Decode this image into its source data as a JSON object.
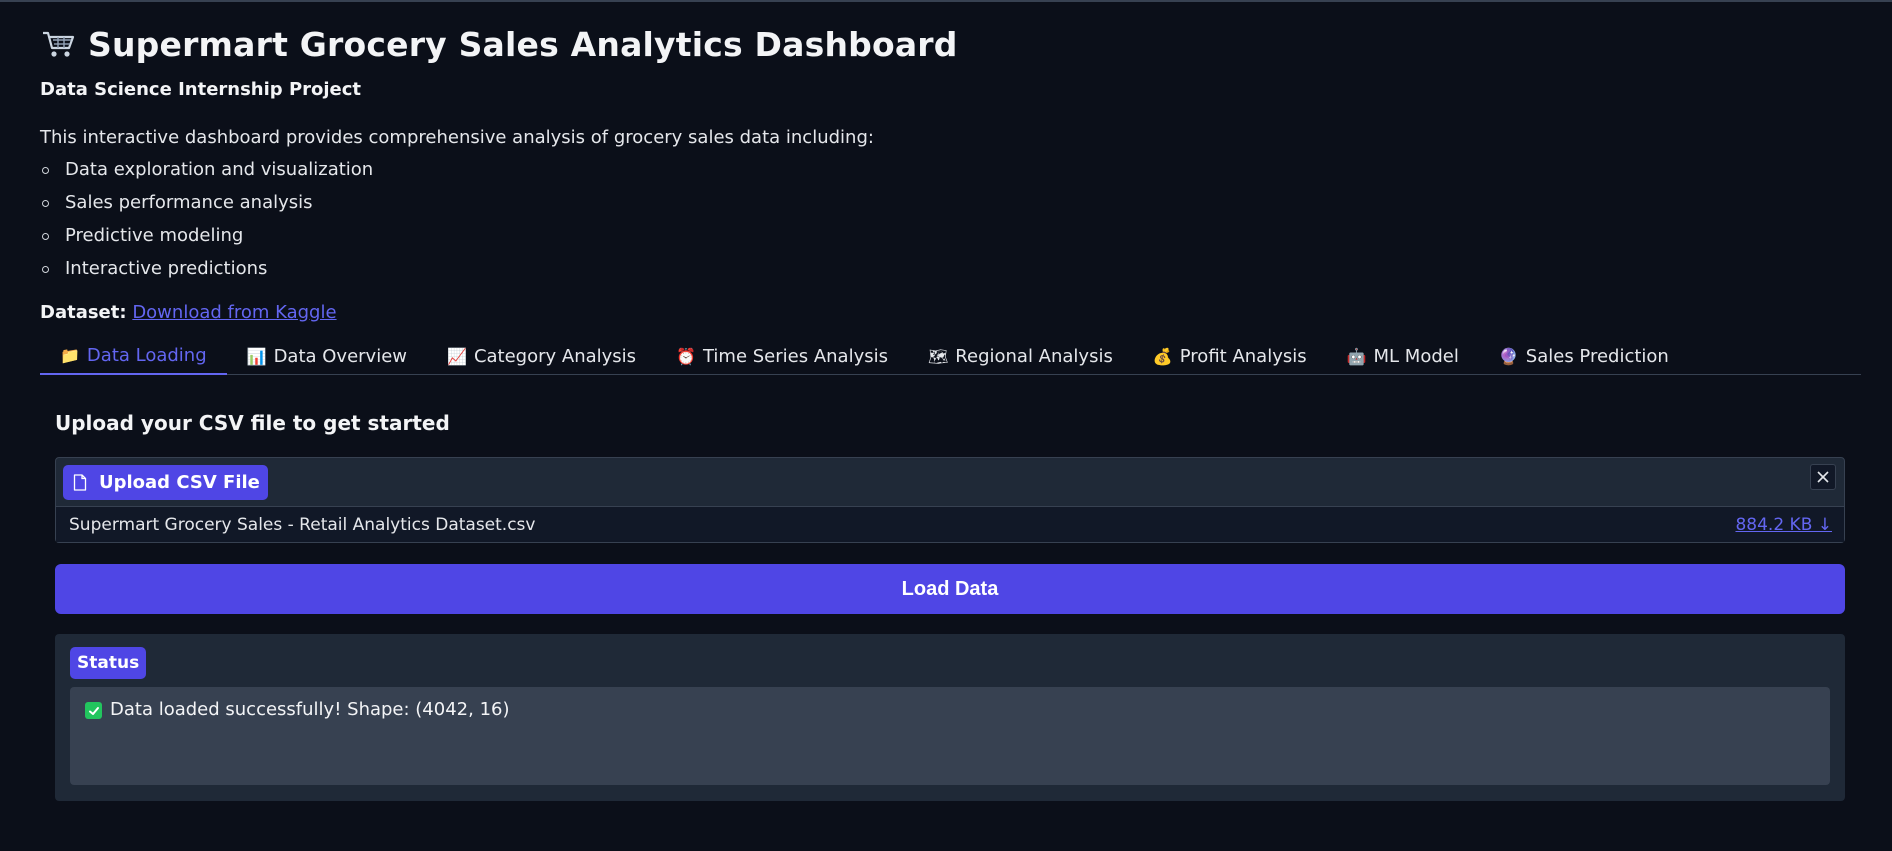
{
  "header": {
    "title": "Supermart Grocery Sales Analytics Dashboard",
    "subtitle": "Data Science Internship Project",
    "intro": "This interactive dashboard provides comprehensive analysis of grocery sales data including:",
    "features": [
      "Data exploration and visualization",
      "Sales performance analysis",
      "Predictive modeling",
      "Interactive predictions"
    ],
    "dataset_label": "Dataset:",
    "dataset_link": "Download from Kaggle"
  },
  "tabs": [
    {
      "label": "Data Loading",
      "icon": "📁",
      "active": true
    },
    {
      "label": "Data Overview",
      "icon": "📊"
    },
    {
      "label": "Category Analysis",
      "icon": "📈"
    },
    {
      "label": "Time Series Analysis",
      "icon": "⏰"
    },
    {
      "label": "Regional Analysis",
      "icon": "🗺"
    },
    {
      "label": "Profit Analysis",
      "icon": "💰"
    },
    {
      "label": "ML Model",
      "icon": "🤖"
    },
    {
      "label": "Sales Prediction",
      "icon": "🔮"
    }
  ],
  "upload": {
    "section_title": "Upload your CSV file to get started",
    "button_label": "Upload CSV File",
    "file_name": "Supermart Grocery Sales - Retail Analytics Dataset.csv",
    "file_size": "884.2 KB ↓"
  },
  "load_button": "Load Data",
  "status": {
    "badge": "Status",
    "message": "Data loaded successfully! Shape: (4042, 16)"
  },
  "colors": {
    "background": "#0b0f19",
    "accent": "#4f46e5",
    "link": "#6366f1",
    "panel": "#1f2937",
    "success": "#22c55e"
  }
}
